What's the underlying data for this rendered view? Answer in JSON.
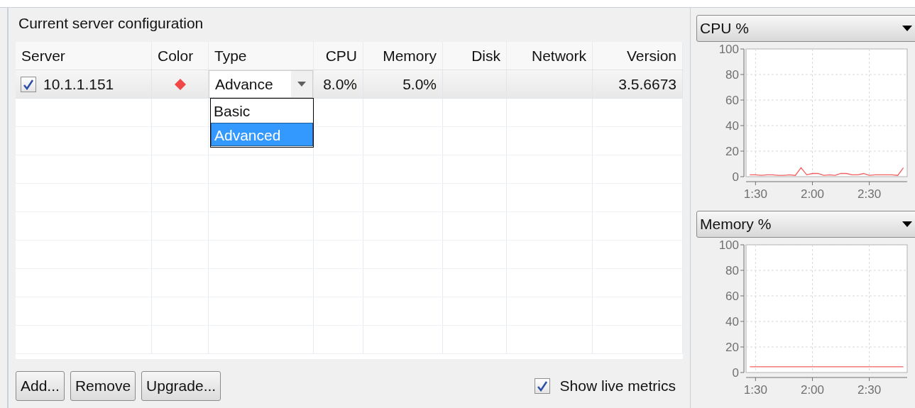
{
  "panel": {
    "title": "Current server configuration"
  },
  "table": {
    "columns": [
      {
        "label": "Server"
      },
      {
        "label": "Color"
      },
      {
        "label": "Type"
      },
      {
        "label": "CPU"
      },
      {
        "label": "Memory"
      },
      {
        "label": "Disk"
      },
      {
        "label": "Network"
      },
      {
        "label": "Version"
      }
    ],
    "rows": [
      {
        "checked": true,
        "server": "10.1.1.151",
        "color": "#f04848",
        "type": "Advance",
        "cpu": "8.0%",
        "memory": "5.0%",
        "version": "3.5.6673"
      }
    ]
  },
  "type_dropdown": {
    "options": [
      {
        "label": "Basic",
        "selected": false
      },
      {
        "label": "Advanced",
        "selected": true
      }
    ]
  },
  "buttons": [
    "Add...",
    "Remove",
    "Upgrade..."
  ],
  "show_live_metrics": {
    "label": "Show live metrics",
    "checked": true
  },
  "metric_panels": [
    {
      "selector": "CPU %",
      "chart_data": {
        "type": "line",
        "x": [
          87,
          90,
          93,
          96,
          99,
          102,
          105,
          108,
          111,
          114,
          117,
          120,
          123,
          126,
          129,
          132,
          135,
          138,
          141,
          144,
          147,
          150,
          153,
          156,
          159,
          162,
          165,
          168
        ],
        "grid": true,
        "series": [
          {
            "color": "#f06060",
            "values": [
              1.5,
              1.5,
              1,
              1.5,
              1.5,
              1,
              1,
              1.5,
              1,
              7,
              1.5,
              2.5,
              2.5,
              1,
              1.5,
              1,
              2.5,
              2.5,
              1.5,
              1.5,
              2.5,
              1,
              1.5,
              1.5,
              1.5,
              1.5,
              1,
              7
            ]
          }
        ],
        "xlim": [
          85,
          170
        ],
        "ylim": [
          0,
          100
        ],
        "xticks": [
          {
            "value": 90,
            "label": "1:30"
          },
          {
            "value": 120,
            "label": "2:00"
          },
          {
            "value": 150,
            "label": "2:30"
          }
        ],
        "yticks": [
          0,
          20,
          40,
          60,
          80,
          100
        ]
      }
    },
    {
      "selector": "Memory %",
      "chart_data": {
        "type": "line",
        "x": [
          87,
          168
        ],
        "grid": true,
        "series": [
          {
            "color": "#f06060",
            "values": [
              4.5,
              4.5
            ]
          }
        ],
        "xlim": [
          85,
          170
        ],
        "ylim": [
          0,
          100
        ],
        "xticks": [
          {
            "value": 90,
            "label": "1:30"
          },
          {
            "value": 120,
            "label": "2:00"
          },
          {
            "value": 150,
            "label": "2:30"
          }
        ],
        "yticks": [
          0,
          20,
          40,
          60,
          80,
          100
        ]
      }
    }
  ]
}
